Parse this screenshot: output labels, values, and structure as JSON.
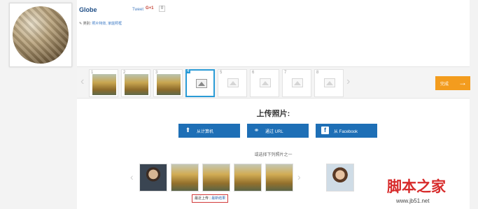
{
  "profile": {
    "title": "Globe",
    "tweet_label": "Tweet",
    "gplus_label": "G+1",
    "gplus_count": "0",
    "tags_prefix": "✎ 类别:",
    "tags_links": "照片特效, 家庭照框"
  },
  "strip": {
    "slots": [
      {
        "num": "1",
        "filled": true
      },
      {
        "num": "2",
        "filled": true
      },
      {
        "num": "3",
        "filled": true
      },
      {
        "num": "4",
        "filled": false,
        "active": true
      },
      {
        "num": "5",
        "filled": false
      },
      {
        "num": "6",
        "filled": false
      },
      {
        "num": "7",
        "filled": false
      },
      {
        "num": "8",
        "filled": false
      }
    ],
    "next_label": "完成"
  },
  "upload": {
    "title": "上传照片:",
    "computer_label": "从计算机",
    "url_label": "通过 URL",
    "facebook_label": "从 Facebook",
    "or_text": "或选择下列照片之一"
  },
  "hint": {
    "recent": "最近上传",
    "separator": "|",
    "results": "最新结果"
  },
  "watermark": {
    "text": "脚本之家",
    "url": "www.jb51.net"
  },
  "colors": {
    "accent_blue": "#1e6fb6",
    "next_orange": "#f39c1e",
    "active_border": "#2a9bd6",
    "hint_border": "#d23a3a",
    "watermark": "#d72b2b"
  },
  "icons": {
    "computer": "upload-arrow-icon",
    "url": "link-icon",
    "facebook": "facebook-icon",
    "next": "arrow-right-icon"
  }
}
